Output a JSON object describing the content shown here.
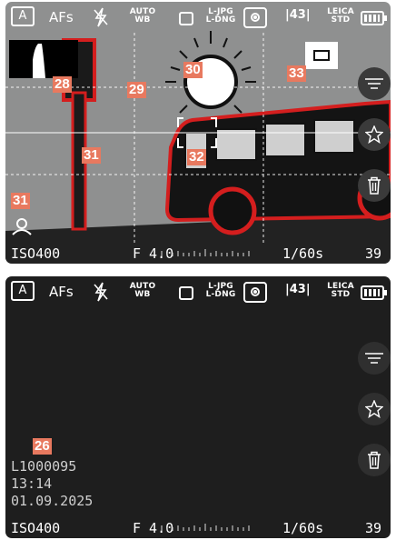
{
  "topbar": {
    "mode": "A",
    "focus_mode": "AFs",
    "flash_icon": "flash-off-icon",
    "white_balance_line1": "AUTO",
    "white_balance_line2": "WB",
    "drive_icon": "single-frame-icon",
    "file_format_line1": "L-JPG",
    "file_format_line2": "L-DNG",
    "metering_icon": "center-weighted-metering-icon",
    "aspect_ratio": "43",
    "look_line1": "LEICA",
    "look_line2": "STD",
    "battery_icon": "battery-full-icon"
  },
  "bottombar": {
    "iso": "ISO400",
    "aperture": "F 4.0",
    "shutter": "1/60s",
    "shots_remaining": "39"
  },
  "side_buttons": {
    "menu_icon": "menu-icon",
    "favorite_icon": "star-icon",
    "delete_icon": "trash-icon"
  },
  "live_view": {
    "labels": {
      "histogram": "28",
      "grid": "29",
      "clipping": "30",
      "focus_peaking": "31",
      "focus_peaking_2": "31",
      "af_field": "32",
      "focus_aid": "33"
    }
  },
  "playback": {
    "label_info": "26",
    "file_name": "L1000095",
    "time": "13:14",
    "date": "01.09.2025"
  },
  "colors": {
    "accent_label": "#e8795f",
    "focus_peaking": "#d41e1e"
  }
}
